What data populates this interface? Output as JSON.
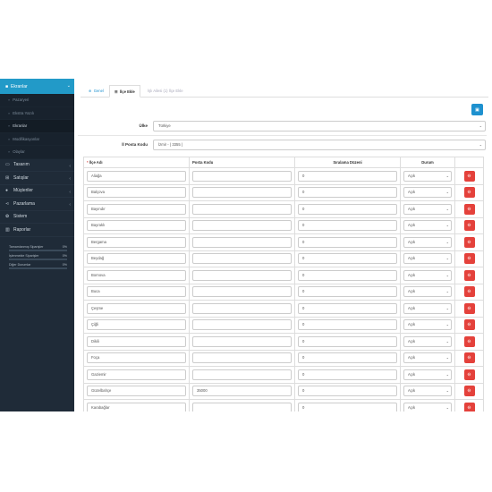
{
  "sidebar": {
    "active_menu": "Ekranlar",
    "sub_items": [
      {
        "label": "Pazaryeri",
        "active": false
      },
      {
        "label": "Ekstra Yazılı",
        "active": false
      },
      {
        "label": "Ekranlar",
        "active": true
      },
      {
        "label": "Modifikasyonlar",
        "active": false
      },
      {
        "label": "Olaylar",
        "active": false
      }
    ],
    "menu_items": [
      {
        "label": "Tasarım",
        "icon": "desktop-icon"
      },
      {
        "label": "Satışlar",
        "icon": "cart-icon"
      },
      {
        "label": "Müşteriler",
        "icon": "user-icon"
      },
      {
        "label": "Pazarlama",
        "icon": "share-icon"
      },
      {
        "label": "Sistem",
        "icon": "gear-icon"
      },
      {
        "label": "Raporlar",
        "icon": "bar-chart-icon"
      }
    ],
    "progress": [
      {
        "label": "Tamamlanmış Siparişler",
        "value": "0%",
        "fraction": 0
      },
      {
        "label": "İşlenmekte Siparişler",
        "value": "0%",
        "fraction": 0
      },
      {
        "label": "Diğer Durumlar",
        "value": "0%",
        "fraction": 0
      }
    ]
  },
  "tabs": [
    {
      "label": "Genel",
      "icon": "circle-plus-icon",
      "state": "link"
    },
    {
      "label": "İlçe Ekle",
      "icon": "list-icon",
      "state": "active"
    },
    {
      "label": "İşlı Ailesi (1) İlçe Ekle",
      "icon": "",
      "state": "muted"
    }
  ],
  "form": {
    "country_label": "Ülke",
    "country_value": "Türkiye",
    "postcode_label": "İl Posta Kodu",
    "postcode_value": "İzmir - ( 3355 )"
  },
  "table": {
    "headers": {
      "district": "İlçe Adı",
      "postcode": "Posta Kodu",
      "sort_order": "Sıralama Düzeni",
      "status": "Durum"
    },
    "rows": [
      {
        "name": "Aliağa",
        "postcode": "",
        "sort": "0",
        "status": "Açık"
      },
      {
        "name": "Balçova",
        "postcode": "",
        "sort": "0",
        "status": "Açık"
      },
      {
        "name": "Bayındır",
        "postcode": "",
        "sort": "0",
        "status": "Açık"
      },
      {
        "name": "Bayraklı",
        "postcode": "",
        "sort": "0",
        "status": "Açık"
      },
      {
        "name": "Bergama",
        "postcode": "",
        "sort": "0",
        "status": "Açık"
      },
      {
        "name": "Beydağ",
        "postcode": "",
        "sort": "0",
        "status": "Açık"
      },
      {
        "name": "Bornova",
        "postcode": "",
        "sort": "0",
        "status": "Açık"
      },
      {
        "name": "Buca",
        "postcode": "",
        "sort": "0",
        "status": "Açık"
      },
      {
        "name": "Çeşme",
        "postcode": "",
        "sort": "0",
        "status": "Açık"
      },
      {
        "name": "Çiğli",
        "postcode": "",
        "sort": "0",
        "status": "Açık"
      },
      {
        "name": "Dikili",
        "postcode": "",
        "sort": "0",
        "status": "Açık"
      },
      {
        "name": "Foça",
        "postcode": "",
        "sort": "0",
        "status": "Açık"
      },
      {
        "name": "Gaziemir",
        "postcode": "",
        "sort": "0",
        "status": "Açık"
      },
      {
        "name": "Güzelbahçe",
        "postcode": "35000",
        "sort": "0",
        "status": "Açık"
      },
      {
        "name": "Karabağlar",
        "postcode": "",
        "sort": "0",
        "status": "Açık"
      }
    ]
  },
  "colors": {
    "sidebar_bg": "#1f2b38",
    "accent": "#229ac8",
    "delete": "#e4413b"
  }
}
